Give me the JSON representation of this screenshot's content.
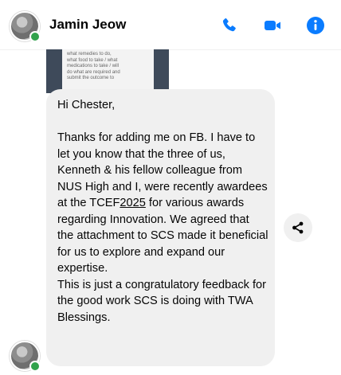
{
  "header": {
    "contact_name": "Jamin Jeow",
    "icons": [
      "phone-icon",
      "video-icon",
      "info-icon"
    ],
    "accent_color": "#0a7cff"
  },
  "attachment": {
    "lines": [
      "what remedies to do,",
      "what food to take / what",
      "medications to take / will",
      "do what are required and",
      "submit the outcome to"
    ]
  },
  "message": {
    "greeting": "Hi Chester,",
    "part1": "Thanks for adding me on FB. I have to let you know that the three of us, Kenneth & his fellow colleague from NUS High and I, were recently awardees at the TCEF",
    "year": "2025",
    "part2": " for various awards regarding Innovation. We agreed that the attachment to SCS made it beneficial for us to explore and expand our expertise.\nThis is just a congratulatory feedback for the good work SCS is doing with TWA  Blessings."
  },
  "presence_color": "#31a24c"
}
